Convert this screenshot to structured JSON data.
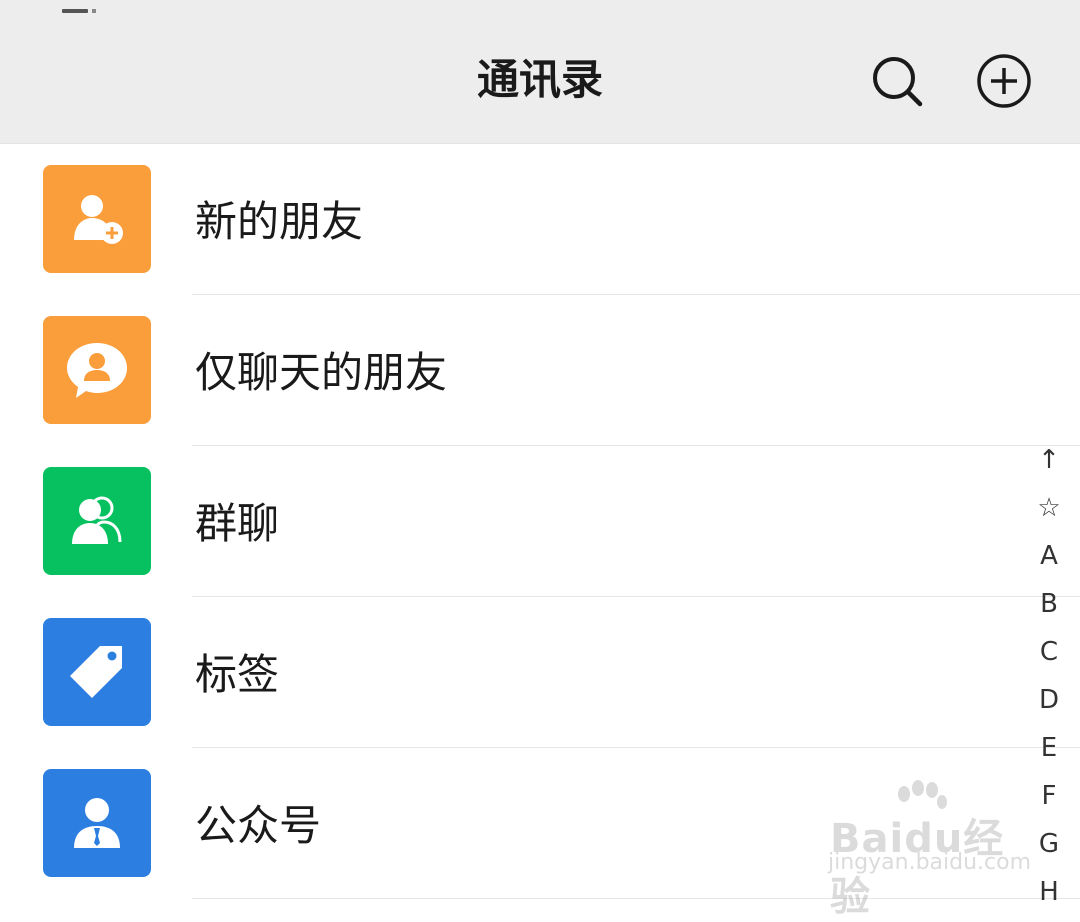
{
  "header": {
    "title": "通讯录",
    "search_icon": "search-icon",
    "add_icon": "plus-circle-icon"
  },
  "rows": [
    {
      "label": "新的朋友",
      "icon": "add-friend-icon",
      "color": "#fa9d3b"
    },
    {
      "label": "仅聊天的朋友",
      "icon": "chat-only-friend-icon",
      "color": "#fa9d3b"
    },
    {
      "label": "群聊",
      "icon": "group-chat-icon",
      "color": "#07c160"
    },
    {
      "label": "标签",
      "icon": "tag-icon",
      "color": "#2c7fe0"
    },
    {
      "label": "公众号",
      "icon": "official-account-icon",
      "color": "#2c7fe0"
    }
  ],
  "index_bar": [
    "↑",
    "☆",
    "A",
    "B",
    "C",
    "D",
    "E",
    "F",
    "G",
    "H"
  ],
  "watermark": {
    "brand": "Baidu经验",
    "url": "jingyan.baidu.com"
  }
}
